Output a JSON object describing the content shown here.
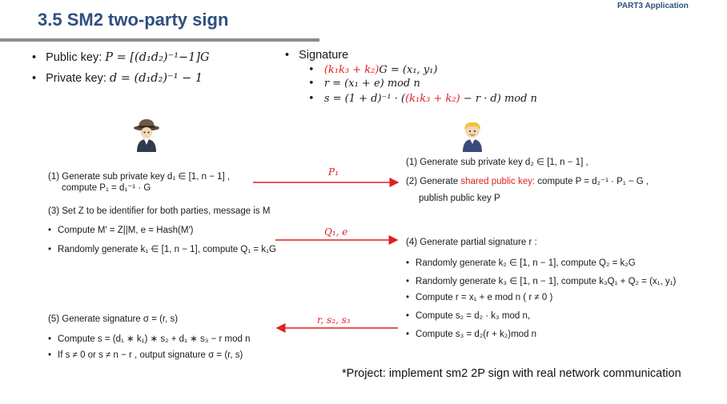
{
  "header": {
    "title": "3.5  SM2 two-party sign",
    "part_label": "PART3  Application"
  },
  "keys": {
    "public_label": "Public key:",
    "public_formula": "P = [(d₁d₂)⁻¹−1]G",
    "private_label": "Private key:",
    "private_formula": "d = (d₁d₂)⁻¹ − 1"
  },
  "signature": {
    "heading": "Signature",
    "line1_red": "(k₁k₃ + k₂)",
    "line1_rest": "G = (x₁, y₁)",
    "line2": "r = (x₁ + e) mod n",
    "line3_a": "s = (1 + d)⁻¹ · (",
    "line3_red": "(k₁k₃ + k₂)",
    "line3_b": " − r · d) mod n"
  },
  "left": {
    "step1_a": "(1) Generate sub private key  d₁ ∈ [1, n − 1]  ,",
    "step1_b": "compute P₁ = d₁⁻¹ · G",
    "step3": "(3) Set Z to be identifier for both parties, message is M",
    "step3_b1": "Compute  M′ = Z||M,  e = Hash(M′)",
    "step3_b2": "Randomly generate  k₁ ∈ [1, n − 1],  compute Q₁ = k₁G",
    "step5": "(5) Generate signature σ = (r, s)",
    "step5_b1": "Compute s = (d₁ ∗ k₁) ∗ s₂ + d₁ ∗ s₃ − r mod n",
    "step5_b2": "If s ≠ 0  or  s ≠ n − r ,  output signature σ = (r, s)"
  },
  "right": {
    "step1": "(1) Generate sub private key d₂ ∈ [1, n − 1] ,",
    "step2_a": "(2) Generate ",
    "step2_red": "shared public key:",
    "step2_b": " compute  P = d₂⁻¹ · P₁ − G ,",
    "step2_c": "publish public key P",
    "step4": "(4) Generate partial signature  r  :",
    "step4_b1": "Randomly generate k₂ ∈ [1, n − 1], compute Q₂ = k₂G",
    "step4_b2": "Randomly generate k₃ ∈ [1, n − 1], compute k₃Q₁ + Q₂ = (x₁, y₁)",
    "step4_b3": "Compute  r = x₁ + e mod n  ( r ≠ 0 )",
    "step4_b4": "Compute  s₂ = d₂ · k₃ mod n,",
    "step4_b5": "Compute  s₃ = d₂(r + k₂)mod n"
  },
  "arrows": {
    "msg1": "P₁",
    "msg2": "Q₁, e",
    "msg3": "r, s₂, s₃"
  },
  "footer": {
    "project": "*Project: implement sm2 2P sign with real network communication"
  },
  "colors": {
    "title": "#2f4f7f",
    "accent_red": "#e02020",
    "rule_gray": "#8c8c8c"
  },
  "icons": {
    "left_party": "detective-avatar-icon",
    "right_party": "blond-person-avatar-icon"
  }
}
